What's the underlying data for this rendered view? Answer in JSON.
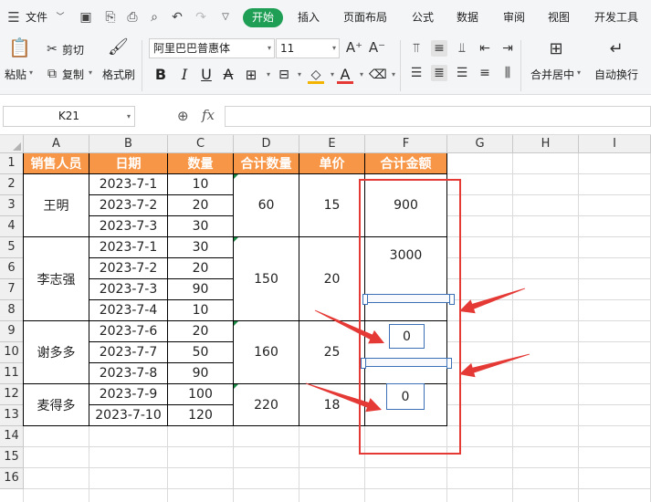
{
  "menubar": {
    "file_label": "文件",
    "tabs": [
      "开始",
      "插入",
      "页面布局",
      "公式",
      "数据",
      "审阅",
      "视图",
      "开发工具"
    ]
  },
  "ribbon": {
    "paste": "粘贴",
    "cut": "剪切",
    "copy": "复制",
    "format_painter": "格式刷",
    "font_name": "阿里巴巴普惠体",
    "font_size": "11",
    "merge_center": "合并居中",
    "wrap_text": "自动换行"
  },
  "formula_bar": {
    "name_box": "K21",
    "fx_label": "fx",
    "formula": ""
  },
  "columns": [
    "A",
    "B",
    "C",
    "D",
    "E",
    "F",
    "G",
    "H",
    "I"
  ],
  "rows": [
    "1",
    "2",
    "3",
    "4",
    "5",
    "6",
    "7",
    "8",
    "9",
    "10",
    "11",
    "12",
    "13",
    "14",
    "15",
    "16"
  ],
  "table": {
    "headers": [
      "销售人员",
      "日期",
      "数量",
      "合计数量",
      "单价",
      "合计金额"
    ],
    "dates": [
      "2023-7-1",
      "2023-7-2",
      "2023-7-3",
      "2023-7-1",
      "2023-7-2",
      "2023-7-3",
      "2023-7-4",
      "2023-7-6",
      "2023-7-7",
      "2023-7-8",
      "2023-7-9",
      "2023-7-10"
    ],
    "quantities": [
      "10",
      "20",
      "30",
      "30",
      "20",
      "90",
      "10",
      "20",
      "50",
      "90",
      "100",
      "120"
    ],
    "groups": [
      {
        "name": "王明",
        "total_qty": "60",
        "price": "15",
        "total_amount": "900"
      },
      {
        "name": "李志强",
        "total_qty": "150",
        "price": "20",
        "total_amount": "3000"
      },
      {
        "name": "谢多多",
        "total_qty": "160",
        "price": "25"
      },
      {
        "name": "麦得多",
        "total_qty": "220",
        "price": "18"
      }
    ],
    "textbox_values": [
      "0",
      "0"
    ]
  },
  "colors": {
    "header_fill": "#f79646",
    "tab_active": "#1e9f55",
    "annotation_red": "#e53935"
  }
}
